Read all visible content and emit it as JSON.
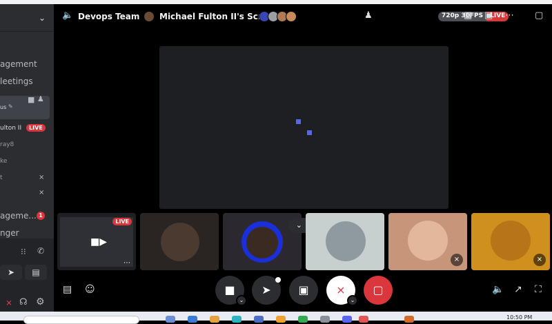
{
  "sidebar": {
    "items": [
      {
        "label": "agement"
      },
      {
        "label": "leetings"
      },
      {
        "label": "us"
      },
      {
        "label": "ulton II",
        "live": "LIVE"
      },
      {
        "label": "ray8"
      },
      {
        "label": "ke"
      },
      {
        "label": "t"
      },
      {
        "label": "agemе..."
      },
      {
        "label": "nger"
      }
    ],
    "badge_count": "1"
  },
  "header": {
    "channel": "Devops Team",
    "stream_title": "Michael Fulton II's Screen",
    "quality": "720p 30FPS",
    "live": "LIVE"
  },
  "tiles": [
    {
      "name": "screen-preview",
      "live": "LIVE",
      "bg": "#1e1f22"
    },
    {
      "name": "participant-1",
      "bg": "#2a2522"
    },
    {
      "name": "participant-2",
      "bg": "#2b2830"
    },
    {
      "name": "participant-3",
      "bg": "#c8cfcf"
    },
    {
      "name": "participant-4",
      "bg": "#c7967a"
    },
    {
      "name": "participant-5",
      "bg": "#d0901e"
    }
  ],
  "taskbar": {
    "clock": "10:50 PM"
  },
  "colors": {
    "accent": "#5865f2",
    "danger": "#da373c",
    "bg": "#000000"
  }
}
